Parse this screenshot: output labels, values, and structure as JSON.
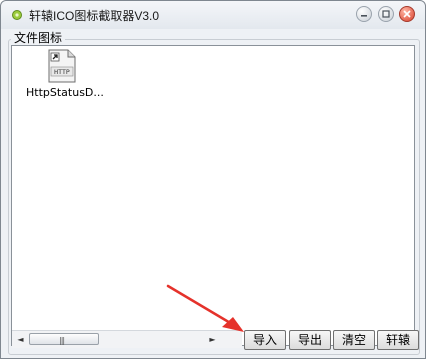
{
  "window": {
    "title": "轩辕ICO图标截取器V3.0"
  },
  "group": {
    "label": "文件图标"
  },
  "files": [
    {
      "label": "HttpStatusD...",
      "icon": "http-file-icon",
      "icon_text": "HTTP"
    }
  ],
  "buttons": {
    "import": "导入",
    "export": "导出",
    "clear": "清空",
    "xuanyuan": "轩辕"
  },
  "scrollbar": {
    "left_arrow": "◄",
    "right_arrow": "►",
    "grip": "|||"
  },
  "colors": {
    "annotation_arrow": "#e5322b",
    "close_button": "#d8402b"
  }
}
